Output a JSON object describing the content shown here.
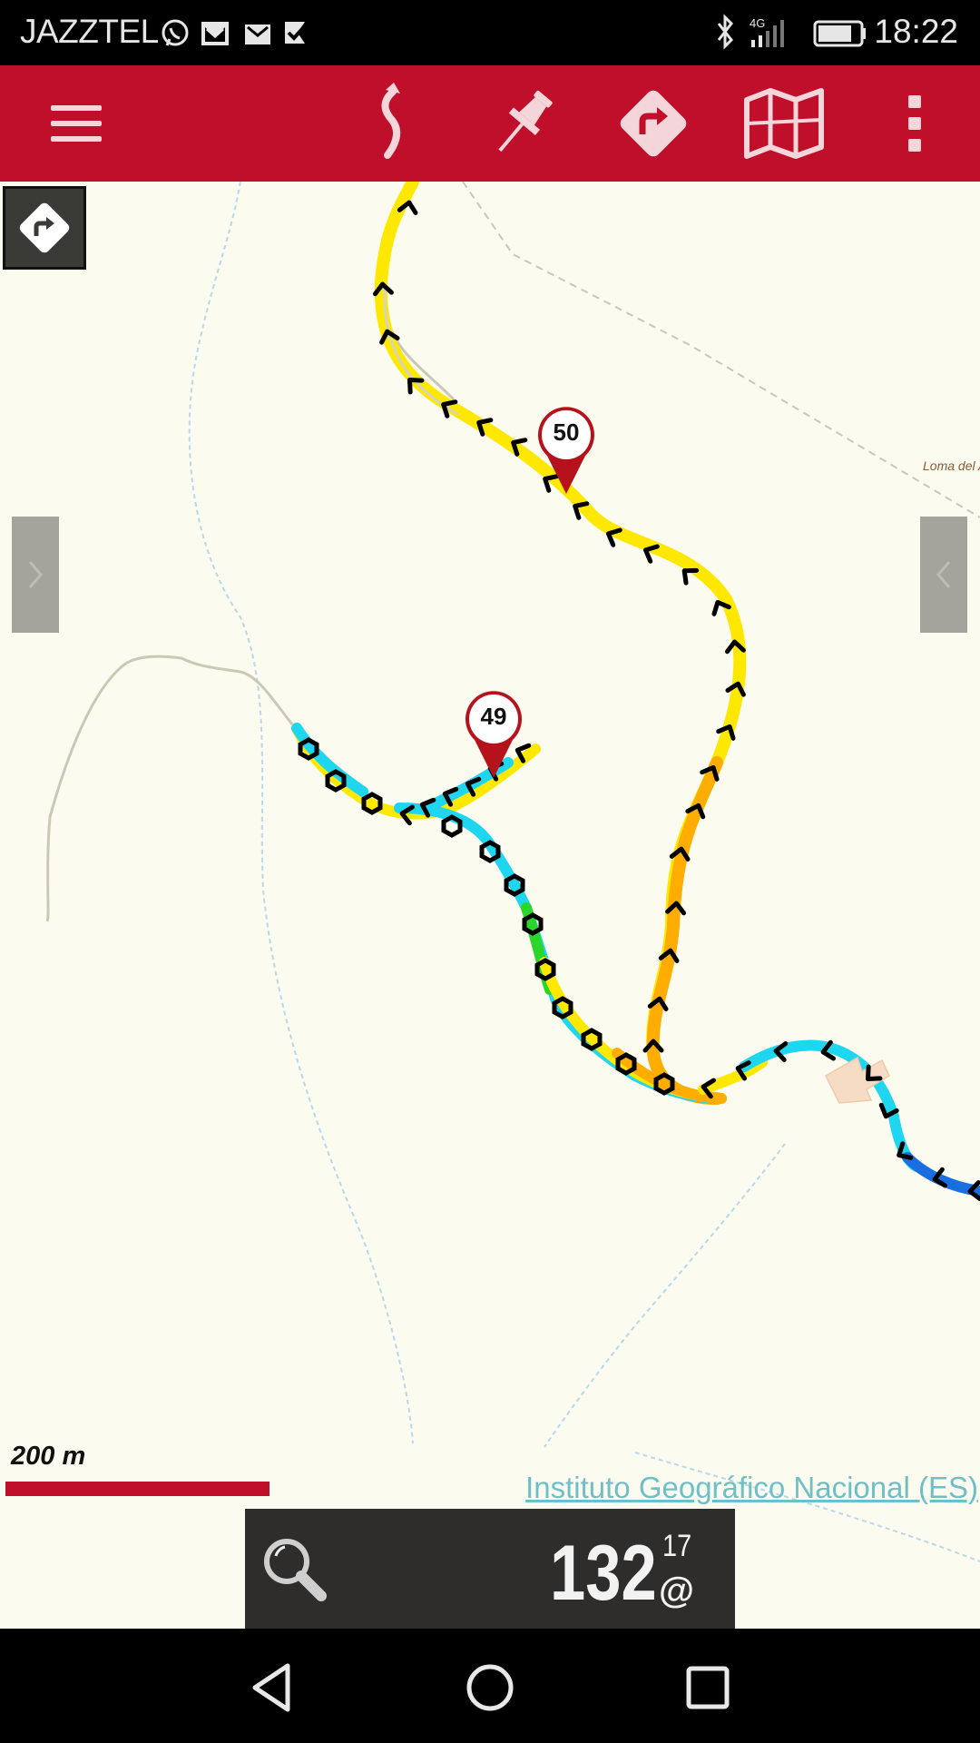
{
  "status_bar": {
    "carrier": "JAZZTEL",
    "network_type": "4G",
    "time": "18:22",
    "icons": [
      "whatsapp-icon",
      "gmail-icon",
      "gmail-icon",
      "checklist-icon",
      "bluetooth-icon",
      "signal-icon",
      "battery-icon"
    ]
  },
  "toolbar": {
    "buttons": [
      "menu-icon",
      "route-icon",
      "pushpin-icon",
      "directions-icon",
      "map-icon",
      "more-vert-icon"
    ],
    "color": "#c00f2a"
  },
  "map": {
    "waypoints": [
      {
        "label": "50"
      },
      {
        "label": "49"
      }
    ],
    "place_label": "Loma del A",
    "scale_label": "200 m",
    "attribution": "Instituto Geográfico Nacional (ES)",
    "colors": {
      "background": "#fbfbf0",
      "track_yellow": "#ffe800",
      "track_orange": "#ffad00",
      "track_cyan": "#1fd6f0",
      "track_blue": "#1a6fe0",
      "track_green": "#2bd62b"
    }
  },
  "info_panel": {
    "counter": "132",
    "counter_sup": "17",
    "counter_suffix": "@"
  },
  "nav_bar": {
    "buttons": [
      "back-icon",
      "home-icon",
      "recents-icon"
    ]
  }
}
